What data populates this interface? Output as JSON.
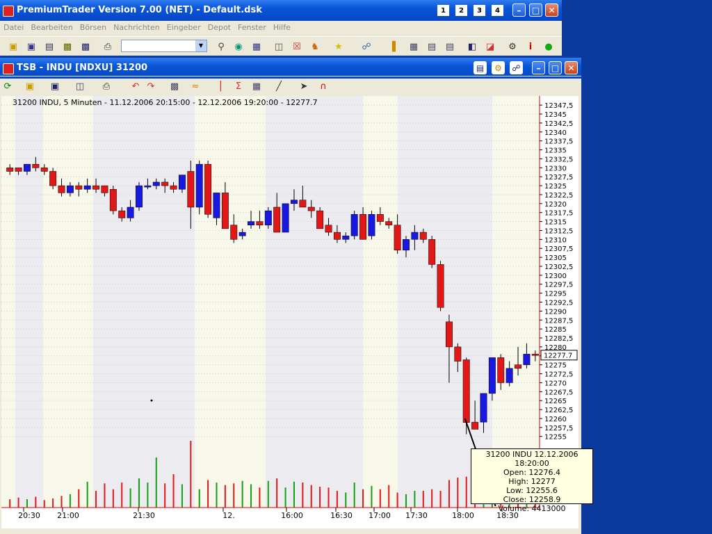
{
  "main_window": {
    "title": "PremiumTrader Version 7.00 (NET) - Default.dsk",
    "desk_buttons": [
      "1",
      "2",
      "3",
      "4"
    ],
    "menu": [
      "Datei",
      "Bearbeiten",
      "Börsen",
      "Nachrichten",
      "Eingeber",
      "Depot",
      "Fenster",
      "Hilfe"
    ]
  },
  "chart_window": {
    "title": "TSB - INDU [NDXU] 31200",
    "info_line": "31200  INDU, 5 Minuten - 11.12.2006 20:15:00 - 12.12.2006 19:20:00 - 12277.7"
  },
  "chart_data": {
    "type": "candlestick",
    "y_ticks": [
      "12347,5",
      "12345",
      "12342,5",
      "12340",
      "12337,5",
      "12335",
      "12332,5",
      "12330",
      "12327,5",
      "12325",
      "12322,5",
      "12320",
      "12317,5",
      "12315",
      "12312,5",
      "12310",
      "12307,5",
      "12305",
      "12302,5",
      "12300",
      "12297,5",
      "12295",
      "12292,5",
      "12290",
      "12287,5",
      "12285",
      "12282,5",
      "12280",
      "12277,5",
      "12275",
      "12272,5",
      "12270",
      "12267,5",
      "12265",
      "12262,5",
      "12260",
      "12257,5",
      "12255"
    ],
    "y_range": [
      12253,
      12348.5
    ],
    "last_price_label": "12277.7",
    "x_tick_labels": [
      "20:30",
      "21:00",
      "21:30",
      "12.",
      "16:00",
      "16:30",
      "17:00",
      "17:30",
      "18:00",
      "18:30"
    ],
    "candles": [
      {
        "o": 12330,
        "h": 12331,
        "l": 12328,
        "c": 12329,
        "dir": "down"
      },
      {
        "o": 12329,
        "h": 12330,
        "l": 12328,
        "c": 12330,
        "dir": "down"
      },
      {
        "o": 12329,
        "h": 12331,
        "l": 12328,
        "c": 12331,
        "dir": "up"
      },
      {
        "o": 12331,
        "h": 12333,
        "l": 12329,
        "c": 12330,
        "dir": "down"
      },
      {
        "o": 12330,
        "h": 12331,
        "l": 12328,
        "c": 12329,
        "dir": "down"
      },
      {
        "o": 12329,
        "h": 12330,
        "l": 12324,
        "c": 12325,
        "dir": "down"
      },
      {
        "o": 12325,
        "h": 12327,
        "l": 12322,
        "c": 12323,
        "dir": "down"
      },
      {
        "o": 12323,
        "h": 12326,
        "l": 12322,
        "c": 12325,
        "dir": "up"
      },
      {
        "o": 12325,
        "h": 12326,
        "l": 12322,
        "c": 12324,
        "dir": "down"
      },
      {
        "o": 12324,
        "h": 12327,
        "l": 12323,
        "c": 12325,
        "dir": "up"
      },
      {
        "o": 12325,
        "h": 12327,
        "l": 12323,
        "c": 12324,
        "dir": "down"
      },
      {
        "o": 12325,
        "h": 12325,
        "l": 12322,
        "c": 12323,
        "dir": "down"
      },
      {
        "o": 12324,
        "h": 12325,
        "l": 12317,
        "c": 12318,
        "dir": "down"
      },
      {
        "o": 12318,
        "h": 12319,
        "l": 12315,
        "c": 12316,
        "dir": "down"
      },
      {
        "o": 12316,
        "h": 12321,
        "l": 12315,
        "c": 12319,
        "dir": "up"
      },
      {
        "o": 12319,
        "h": 12326,
        "l": 12318,
        "c": 12325,
        "dir": "up"
      },
      {
        "o": 12325,
        "h": 12327,
        "l": 12324,
        "c": 12325,
        "dir": "up"
      },
      {
        "o": 12325,
        "h": 12327,
        "l": 12324,
        "c": 12326,
        "dir": "up"
      },
      {
        "o": 12326,
        "h": 12327,
        "l": 12323,
        "c": 12325,
        "dir": "down"
      },
      {
        "o": 12325,
        "h": 12326,
        "l": 12323,
        "c": 12324,
        "dir": "down"
      },
      {
        "o": 12324,
        "h": 12328,
        "l": 12323,
        "c": 12328,
        "dir": "up"
      },
      {
        "o": 12329,
        "h": 12332,
        "l": 12313,
        "c": 12319,
        "dir": "down"
      },
      {
        "o": 12319,
        "h": 12332,
        "l": 12317,
        "c": 12331,
        "dir": "up"
      },
      {
        "o": 12331,
        "h": 12332,
        "l": 12316,
        "c": 12317,
        "dir": "down"
      },
      {
        "o": 12316,
        "h": 12323,
        "l": 12314,
        "c": 12323,
        "dir": "up"
      },
      {
        "o": 12323,
        "h": 12326,
        "l": 12313,
        "c": 12313,
        "dir": "down"
      },
      {
        "o": 12314,
        "h": 12317,
        "l": 12309,
        "c": 12310,
        "dir": "down"
      },
      {
        "o": 12311,
        "h": 12313,
        "l": 12310,
        "c": 12312,
        "dir": "up"
      },
      {
        "o": 12314,
        "h": 12318,
        "l": 12313,
        "c": 12315,
        "dir": "up"
      },
      {
        "o": 12315,
        "h": 12318,
        "l": 12313,
        "c": 12314,
        "dir": "down"
      },
      {
        "o": 12314,
        "h": 12319,
        "l": 12313,
        "c": 12318,
        "dir": "up"
      },
      {
        "o": 12319,
        "h": 12323,
        "l": 12312,
        "c": 12312,
        "dir": "down"
      },
      {
        "o": 12312,
        "h": 12320,
        "l": 12312,
        "c": 12320,
        "dir": "up"
      },
      {
        "o": 12320,
        "h": 12324,
        "l": 12318,
        "c": 12321,
        "dir": "up"
      },
      {
        "o": 12321,
        "h": 12325,
        "l": 12319,
        "c": 12319,
        "dir": "down"
      },
      {
        "o": 12319,
        "h": 12321,
        "l": 12316,
        "c": 12318,
        "dir": "down"
      },
      {
        "o": 12318,
        "h": 12319,
        "l": 12313,
        "c": 12313,
        "dir": "down"
      },
      {
        "o": 12314,
        "h": 12316,
        "l": 12311,
        "c": 12312,
        "dir": "down"
      },
      {
        "o": 12312,
        "h": 12314,
        "l": 12309,
        "c": 12310,
        "dir": "down"
      },
      {
        "o": 12310,
        "h": 12312,
        "l": 12309,
        "c": 12311,
        "dir": "up"
      },
      {
        "o": 12311,
        "h": 12318,
        "l": 12310,
        "c": 12317,
        "dir": "up"
      },
      {
        "o": 12317,
        "h": 12319,
        "l": 12310,
        "c": 12310,
        "dir": "down"
      },
      {
        "o": 12311,
        "h": 12318,
        "l": 12310,
        "c": 12317,
        "dir": "up"
      },
      {
        "o": 12317,
        "h": 12319,
        "l": 12314,
        "c": 12315,
        "dir": "down"
      },
      {
        "o": 12315,
        "h": 12316,
        "l": 12313,
        "c": 12314,
        "dir": "down"
      },
      {
        "o": 12314,
        "h": 12317,
        "l": 12306,
        "c": 12307,
        "dir": "down"
      },
      {
        "o": 12307,
        "h": 12311,
        "l": 12305,
        "c": 12310,
        "dir": "up"
      },
      {
        "o": 12310,
        "h": 12314,
        "l": 12307,
        "c": 12312,
        "dir": "up"
      },
      {
        "o": 12312,
        "h": 12313,
        "l": 12309,
        "c": 12310,
        "dir": "down"
      },
      {
        "o": 12310,
        "h": 12311,
        "l": 12302,
        "c": 12303,
        "dir": "down"
      },
      {
        "o": 12303,
        "h": 12304,
        "l": 12290,
        "c": 12291,
        "dir": "down"
      },
      {
        "o": 12287,
        "h": 12289,
        "l": 12270,
        "c": 12280,
        "dir": "down"
      },
      {
        "o": 12280,
        "h": 12281,
        "l": 12273,
        "c": 12276,
        "dir": "down"
      },
      {
        "o": 12276.4,
        "h": 12277,
        "l": 12255.6,
        "c": 12258.9,
        "dir": "down"
      },
      {
        "o": 12259,
        "h": 12265,
        "l": 12257,
        "c": 12257,
        "dir": "down"
      },
      {
        "o": 12259,
        "h": 12267,
        "l": 12256,
        "c": 12267,
        "dir": "up"
      },
      {
        "o": 12267,
        "h": 12277,
        "l": 12265,
        "c": 12277,
        "dir": "up"
      },
      {
        "o": 12277,
        "h": 12278,
        "l": 12268,
        "c": 12270,
        "dir": "down"
      },
      {
        "o": 12270,
        "h": 12276,
        "l": 12269,
        "c": 12274,
        "dir": "up"
      },
      {
        "o": 12274,
        "h": 12280,
        "l": 12272,
        "c": 12275,
        "dir": "down"
      },
      {
        "o": 12275,
        "h": 12281,
        "l": 12274,
        "c": 12278,
        "dir": "up"
      },
      {
        "o": 12278,
        "h": 12279,
        "l": 12276,
        "c": 12277.7,
        "dir": "down"
      }
    ],
    "volume": [
      0.1,
      0.12,
      0.1,
      0.13,
      0.09,
      0.11,
      0.14,
      0.16,
      0.22,
      0.31,
      0.2,
      0.29,
      0.22,
      0.3,
      0.23,
      0.35,
      0.3,
      0.29,
      0.29,
      0.4,
      0.28,
      0.34,
      0.22,
      0.33,
      0.3,
      0.27,
      0.29,
      0.32,
      0.28,
      0.24,
      0.32,
      0.35,
      0.24,
      0.31,
      0.3,
      0.27,
      0.25,
      0.24,
      0.2,
      0.18,
      0.3,
      0.22,
      0.26,
      0.22,
      0.27,
      0.18,
      0.16,
      0.2,
      0.2,
      0.22,
      0.2,
      0.33,
      0.36,
      0.37,
      0.3,
      0.23,
      0.27,
      0.28,
      0.26,
      0.3,
      0.22,
      0.2
    ],
    "volume_peaks": {
      "21": 0.8,
      "17": 0.6
    }
  },
  "tooltip": {
    "line1": "31200  INDU  12.12.2006 18:20:00",
    "line2": "Open: 12276.4",
    "line3": "High: 12277",
    "line4": "Low: 12255.6",
    "line5": "Close: 12258.9",
    "line6": "Volume: 4413000"
  },
  "colors": {
    "up": "#1818e0",
    "down": "#e01818",
    "vol_up": "#12a012",
    "vol_down": "#e01818"
  }
}
